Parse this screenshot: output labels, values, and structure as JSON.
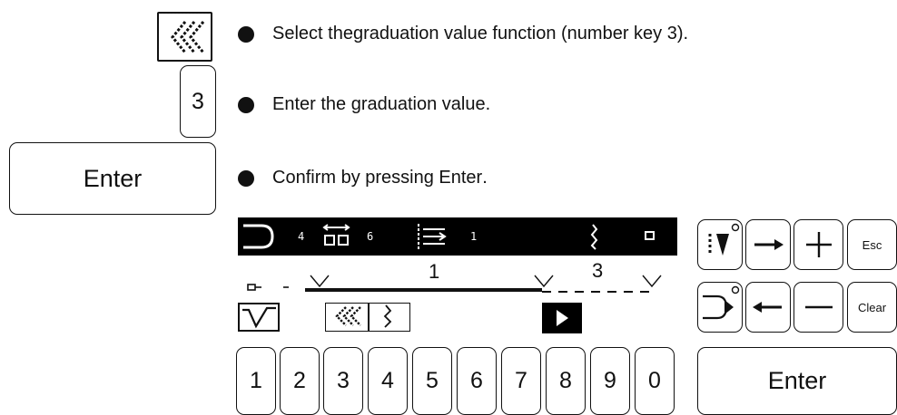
{
  "instructions": {
    "steps": [
      {
        "pre": "Select the ",
        "bold1": "graduation value",
        "mid": " function (",
        "bold2": "number key 3",
        "post": ")."
      },
      {
        "text": "Enter the graduation value."
      },
      {
        "pre": "Confirm by pressing ",
        "bold": "Enter",
        "post": "."
      }
    ],
    "keys": {
      "three": "3",
      "enter": "Enter"
    }
  },
  "display": {
    "status": {
      "val1": "4",
      "val2": "6",
      "val3": "1"
    },
    "scale": {
      "label1": "1",
      "label2": "3"
    },
    "icons": [
      "presser-foot-icon",
      "stitch-length-icon",
      "stitch-width-icon",
      "zigzag-icon",
      "stop-icon",
      "graduation-icon",
      "play-icon"
    ]
  },
  "keypad": {
    "digits": [
      "1",
      "2",
      "3",
      "4",
      "5",
      "6",
      "7",
      "8",
      "9",
      "0"
    ],
    "side": {
      "esc": "Esc",
      "clear": "Clear",
      "enter": "Enter"
    }
  }
}
